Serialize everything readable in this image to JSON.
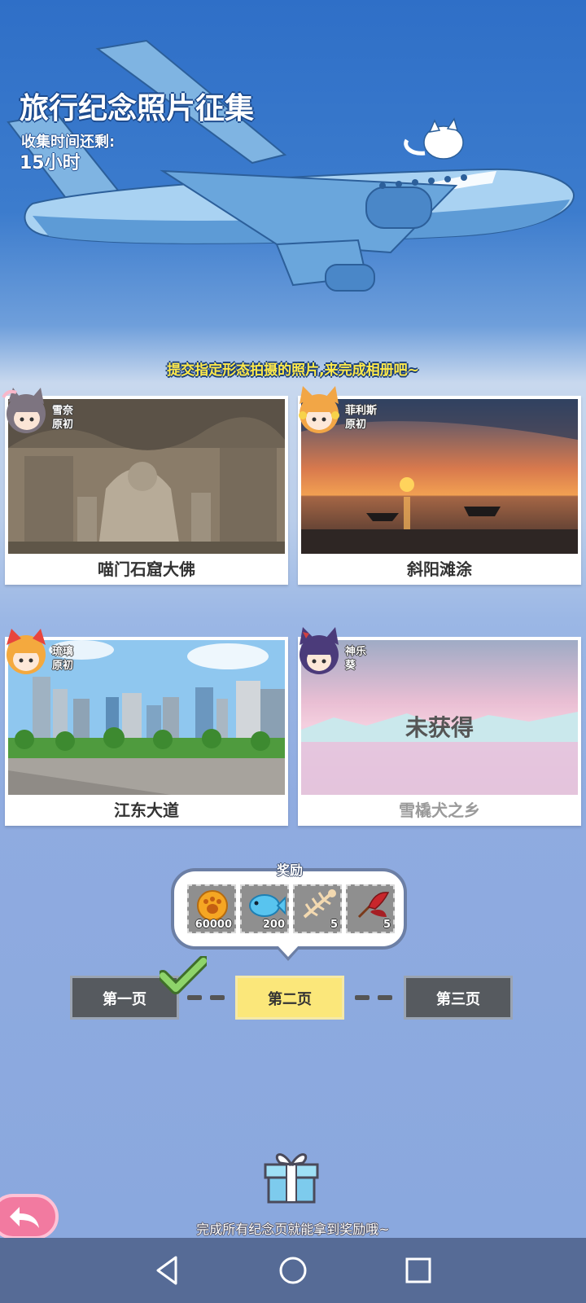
{
  "event": {
    "title": "旅行纪念照片征集",
    "time_label": "收集时间还剩:",
    "time_value": "15小时",
    "instruction": "提交指定形态拍摄的照片,来完成相册吧~"
  },
  "cards": [
    {
      "character": [
        "雪奈",
        "原初"
      ],
      "caption": "喵门石窟大佛",
      "locked": false,
      "locked_text": ""
    },
    {
      "character": [
        "菲利斯",
        "原初"
      ],
      "caption": "斜阳滩涂",
      "locked": false,
      "locked_text": ""
    },
    {
      "character": [
        "琉璃",
        "原初"
      ],
      "caption": "江东大道",
      "locked": false,
      "locked_text": ""
    },
    {
      "character": [
        "神乐",
        "葵"
      ],
      "caption": "雪橇犬之乡",
      "locked": true,
      "locked_text": "未获得"
    }
  ],
  "rewards": {
    "title": "奖励",
    "items": [
      {
        "icon": "cat-paw-coin-icon",
        "count": "60000"
      },
      {
        "icon": "blue-fish-gem-icon",
        "count": "200"
      },
      {
        "icon": "fish-bone-icon",
        "count": "5"
      },
      {
        "icon": "red-feather-icon",
        "count": "5"
      }
    ]
  },
  "pages": {
    "items": [
      {
        "label": "第一页",
        "completed": true,
        "active": false
      },
      {
        "label": "第二页",
        "completed": false,
        "active": true
      },
      {
        "label": "第三页",
        "completed": false,
        "active": false
      }
    ]
  },
  "footer": {
    "text": "完成所有纪念页就能拿到奖励哦~"
  },
  "colors": {
    "sky_top": "#2f6fc7",
    "active_page": "#fbe77a",
    "inactive_page": "#565a5f",
    "instruction_yellow": "#ffe94a",
    "back_button": "#f27aa0"
  }
}
